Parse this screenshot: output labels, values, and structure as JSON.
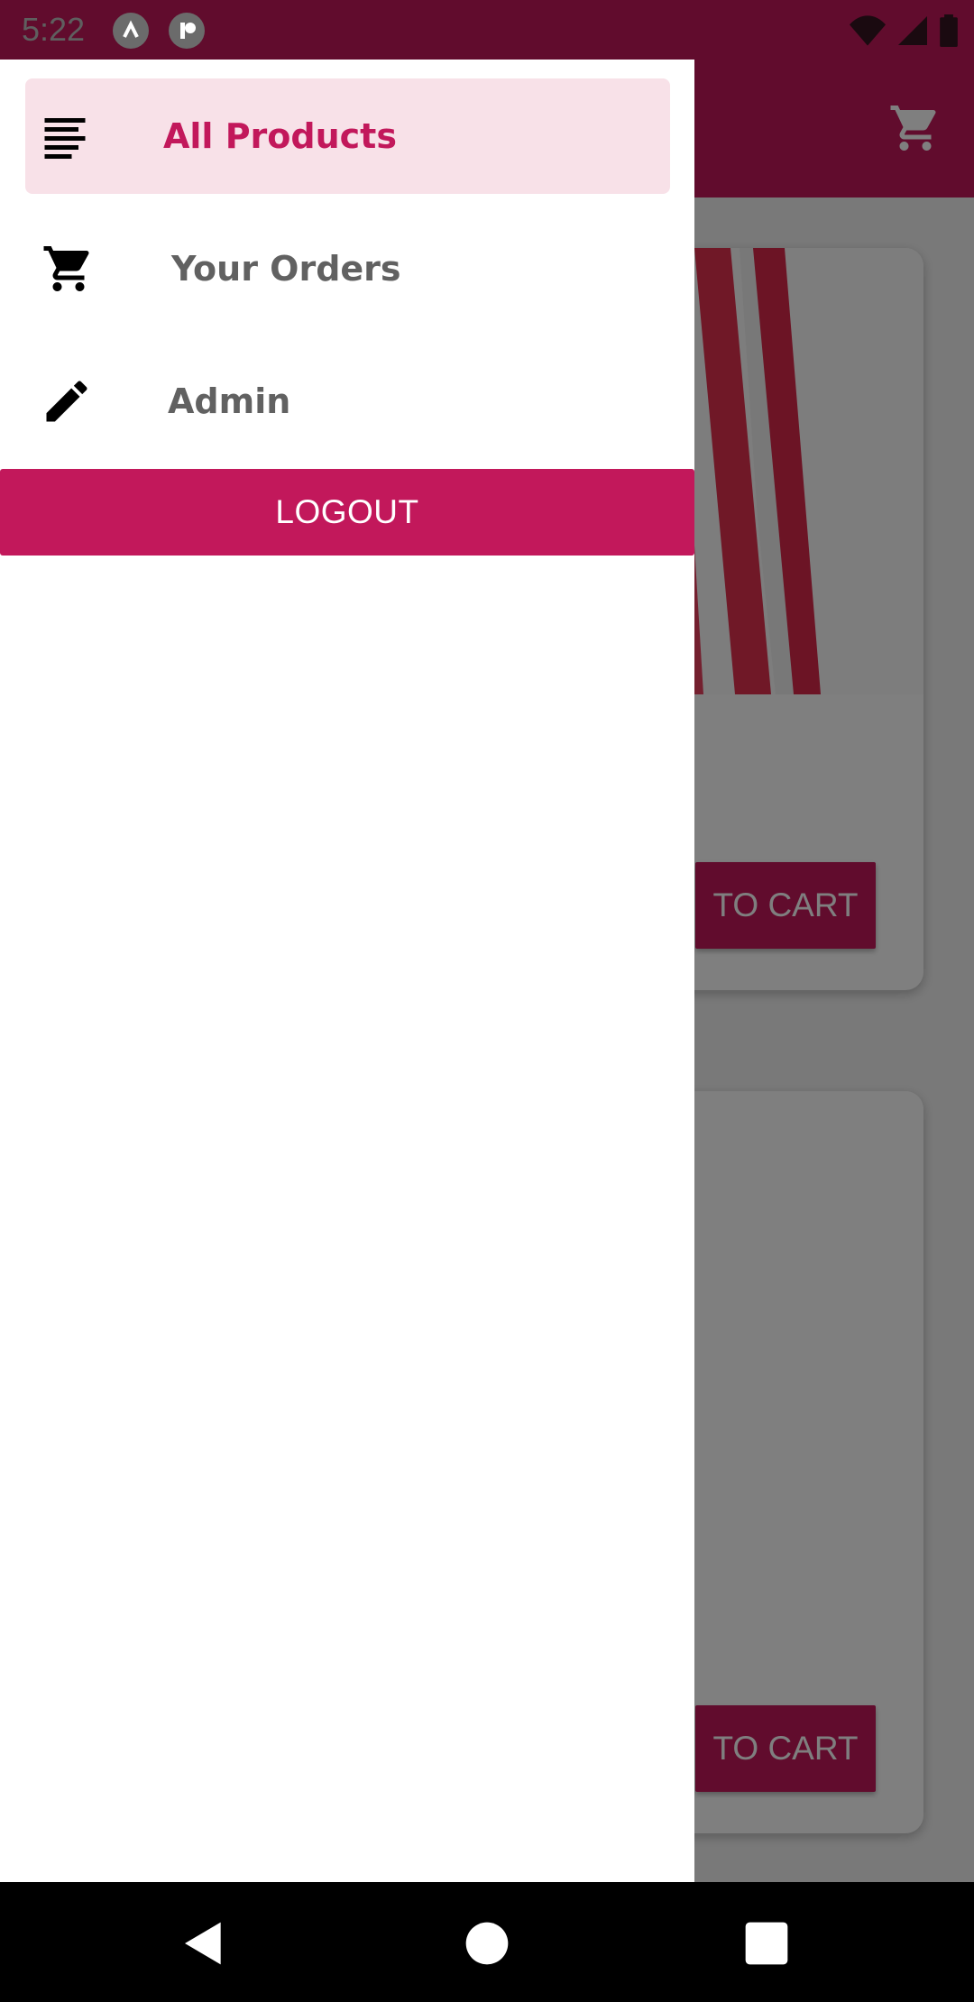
{
  "status_bar": {
    "time": "5:22"
  },
  "drawer": {
    "items": [
      {
        "label": "All Products",
        "icon": "sort-lines-icon",
        "active": true
      },
      {
        "label": "Your Orders",
        "icon": "shopping-cart-icon",
        "active": false
      },
      {
        "label": "Admin",
        "icon": "pencil-icon",
        "active": false
      }
    ],
    "logout_label": "LOGOUT"
  },
  "background": {
    "product_cards": [
      {
        "button_label": "TO CART"
      },
      {
        "button_label": "TO CART"
      }
    ]
  },
  "colors": {
    "primary": "#c2185b",
    "active_item_bg": "#f8e1e8",
    "item_text": "#616161"
  }
}
